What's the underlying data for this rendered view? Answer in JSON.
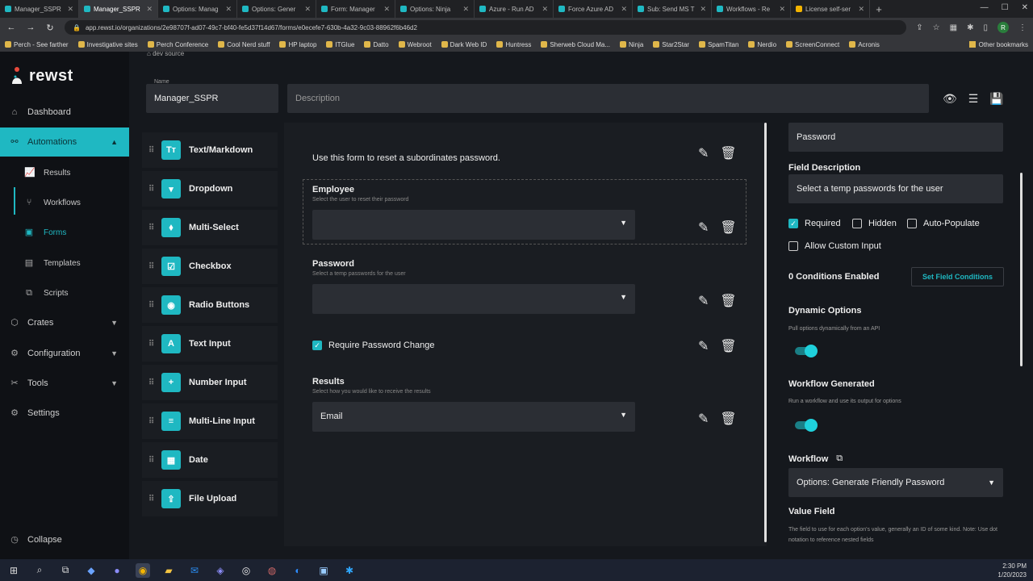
{
  "browser": {
    "tabs": [
      {
        "label": "Manager_SSPR",
        "color": "#1fb8c2"
      },
      {
        "label": "Manager_SSPR",
        "color": "#1fb8c2"
      },
      {
        "label": "Options: Manag",
        "color": "#1fb8c2"
      },
      {
        "label": "Options: Gener",
        "color": "#1fb8c2"
      },
      {
        "label": "Form: Manager",
        "color": "#1fb8c2"
      },
      {
        "label": "Options: Ninja",
        "color": "#1fb8c2"
      },
      {
        "label": "Azure - Run AD",
        "color": "#1fb8c2"
      },
      {
        "label": "Force Azure AD",
        "color": "#1fb8c2"
      },
      {
        "label": "Sub: Send MS T",
        "color": "#1fb8c2"
      },
      {
        "label": "Workflows - Re",
        "color": "#1fb8c2"
      },
      {
        "label": "License self-ser",
        "color": "#f4b400"
      }
    ],
    "url": "app.rewst.io/organizations/2e98707f-ad07-49c7-bf40-fe5d37f14d67/forms/e0ecefe7-630b-4a32-9c03-88962f6b46d2",
    "bookmarks": [
      "Perch - See farther",
      "Investigative sites",
      "Perch Conference",
      "Cool Nerd stuff",
      "HP laptop",
      "ITGlue",
      "Datto",
      "Webroot",
      "Dark Web ID",
      "Huntress",
      "Sherweb Cloud Ma...",
      "Ninja",
      "Star2Star",
      "SpamTitan",
      "Nerdio",
      "ScreenConnect",
      "Acronis"
    ],
    "other_bookmarks": "Other bookmarks"
  },
  "sidebar": {
    "brand": "rewst",
    "items": {
      "dashboard": "Dashboard",
      "automations": "Automations",
      "results": "Results",
      "workflows": "Workflows",
      "forms": "Forms",
      "templates": "Templates",
      "scripts": "Scripts",
      "crates": "Crates",
      "configuration": "Configuration",
      "tools": "Tools",
      "settings": "Settings",
      "collapse": "Collapse"
    }
  },
  "header": {
    "crumb": "dev source",
    "name_label": "Name",
    "name_value": "Manager_SSPR",
    "description_placeholder": "Description"
  },
  "palette": [
    "Text/Markdown",
    "Dropdown",
    "Multi-Select",
    "Checkbox",
    "Radio Buttons",
    "Text Input",
    "Number Input",
    "Multi-Line Input",
    "Date",
    "File Upload"
  ],
  "form": {
    "intro": "Use this form to reset a subordinates password.",
    "employee_title": "Employee",
    "employee_hint": "Select the user to reset their password",
    "password_title": "Password",
    "password_hint": "Select a temp passwords for the user",
    "require_change": "Require Password Change",
    "results_title": "Results",
    "results_hint": "Select how you would like to receive the results",
    "results_value": "Email"
  },
  "panel": {
    "field_name_value": "Password",
    "field_description_title": "Field Description",
    "field_description_value": "Select a temp passwords for the user",
    "required": "Required",
    "hidden": "Hidden",
    "auto_populate": "Auto-Populate",
    "allow_custom": "Allow Custom Input",
    "conditions": "0 Conditions Enabled",
    "set_conditions": "Set Field Conditions",
    "dynamic_title": "Dynamic Options",
    "dynamic_hint": "Pull options dynamically from an API",
    "wfgen_title": "Workflow Generated",
    "wfgen_hint": "Run a workflow and use its output for options",
    "workflow_title": "Workflow",
    "workflow_value": "Options: Generate Friendly Password",
    "value_field_title": "Value Field",
    "value_field_hint": "The field to use for each option's value, generally an ID of some kind. Note: Use dot notation to reference nested fields"
  },
  "taskbar": {
    "time": "2:30 PM",
    "date": "1/20/2023"
  }
}
